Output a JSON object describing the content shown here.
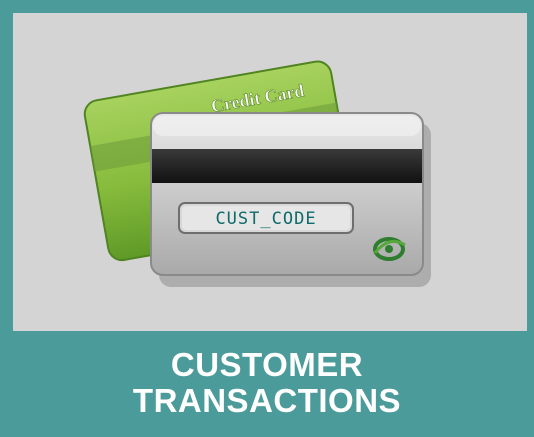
{
  "tile": {
    "label_line1": "CUSTOMER",
    "label_line2": "TRANSACTIONS",
    "icon": "credit-card-icon",
    "colors": {
      "frame": "#4b9b9a",
      "image_background": "#d4d4d4",
      "label_text": "#ffffff"
    }
  },
  "illustration": {
    "back_card_text": "Credit Card",
    "front_card_code": "CUST_CODE",
    "front_card_logo": "chip-swirl-logo-icon"
  }
}
